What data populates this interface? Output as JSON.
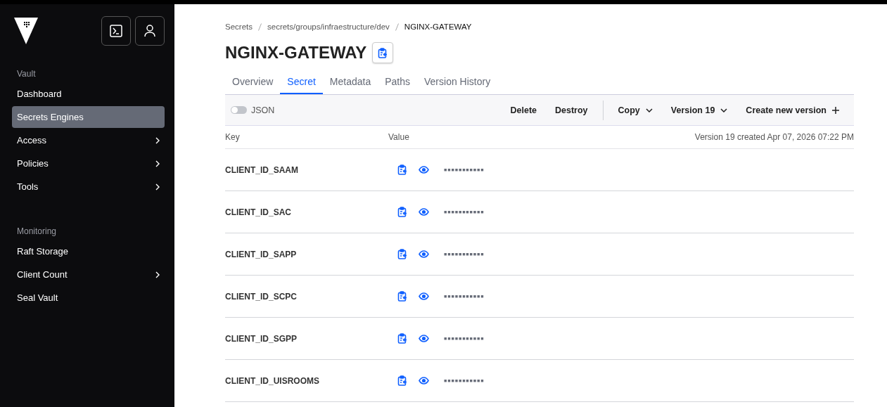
{
  "sidebar": {
    "sections": [
      {
        "heading": "Vault",
        "items": [
          {
            "label": "Dashboard",
            "selected": false,
            "has_submenu": false
          },
          {
            "label": "Secrets Engines",
            "selected": true,
            "has_submenu": false
          },
          {
            "label": "Access",
            "selected": false,
            "has_submenu": true
          },
          {
            "label": "Policies",
            "selected": false,
            "has_submenu": true
          },
          {
            "label": "Tools",
            "selected": false,
            "has_submenu": true
          }
        ]
      },
      {
        "heading": "Monitoring",
        "items": [
          {
            "label": "Raft Storage",
            "selected": false,
            "has_submenu": false
          },
          {
            "label": "Client Count",
            "selected": false,
            "has_submenu": true
          },
          {
            "label": "Seal Vault",
            "selected": false,
            "has_submenu": false
          }
        ]
      }
    ]
  },
  "breadcrumbs": [
    "Secrets",
    "secrets/groups/infraestructure/dev",
    "NGINX-GATEWAY"
  ],
  "title": "NGINX-GATEWAY",
  "tabs": [
    {
      "label": "Overview",
      "selected": false
    },
    {
      "label": "Secret",
      "selected": true
    },
    {
      "label": "Metadata",
      "selected": false
    },
    {
      "label": "Paths",
      "selected": false
    },
    {
      "label": "Version History",
      "selected": false
    }
  ],
  "toolbar": {
    "json_toggle": {
      "label": "JSON",
      "on": false
    },
    "actions": [
      {
        "label": "Delete",
        "kind": "button"
      },
      {
        "label": "Destroy",
        "kind": "button"
      },
      {
        "label": "Copy",
        "kind": "dropdown"
      },
      {
        "label": "Version 19",
        "kind": "dropdown"
      },
      {
        "label": "Create new version",
        "kind": "add"
      }
    ]
  },
  "table": {
    "columns": [
      "Key",
      "Value"
    ],
    "version_note": "Version 19 created Apr 07, 2026 07:22 PM",
    "rows": [
      {
        "key": "CLIENT_ID_SAAM",
        "value": "■■■■■■■■■■■"
      },
      {
        "key": "CLIENT_ID_SAC",
        "value": "■■■■■■■■■■■"
      },
      {
        "key": "CLIENT_ID_SAPP",
        "value": "■■■■■■■■■■■"
      },
      {
        "key": "CLIENT_ID_SCPC",
        "value": "■■■■■■■■■■■"
      },
      {
        "key": "CLIENT_ID_SGPP",
        "value": "■■■■■■■■■■■"
      },
      {
        "key": "CLIENT_ID_UISROOMS",
        "value": "■■■■■■■■■■■"
      }
    ]
  }
}
